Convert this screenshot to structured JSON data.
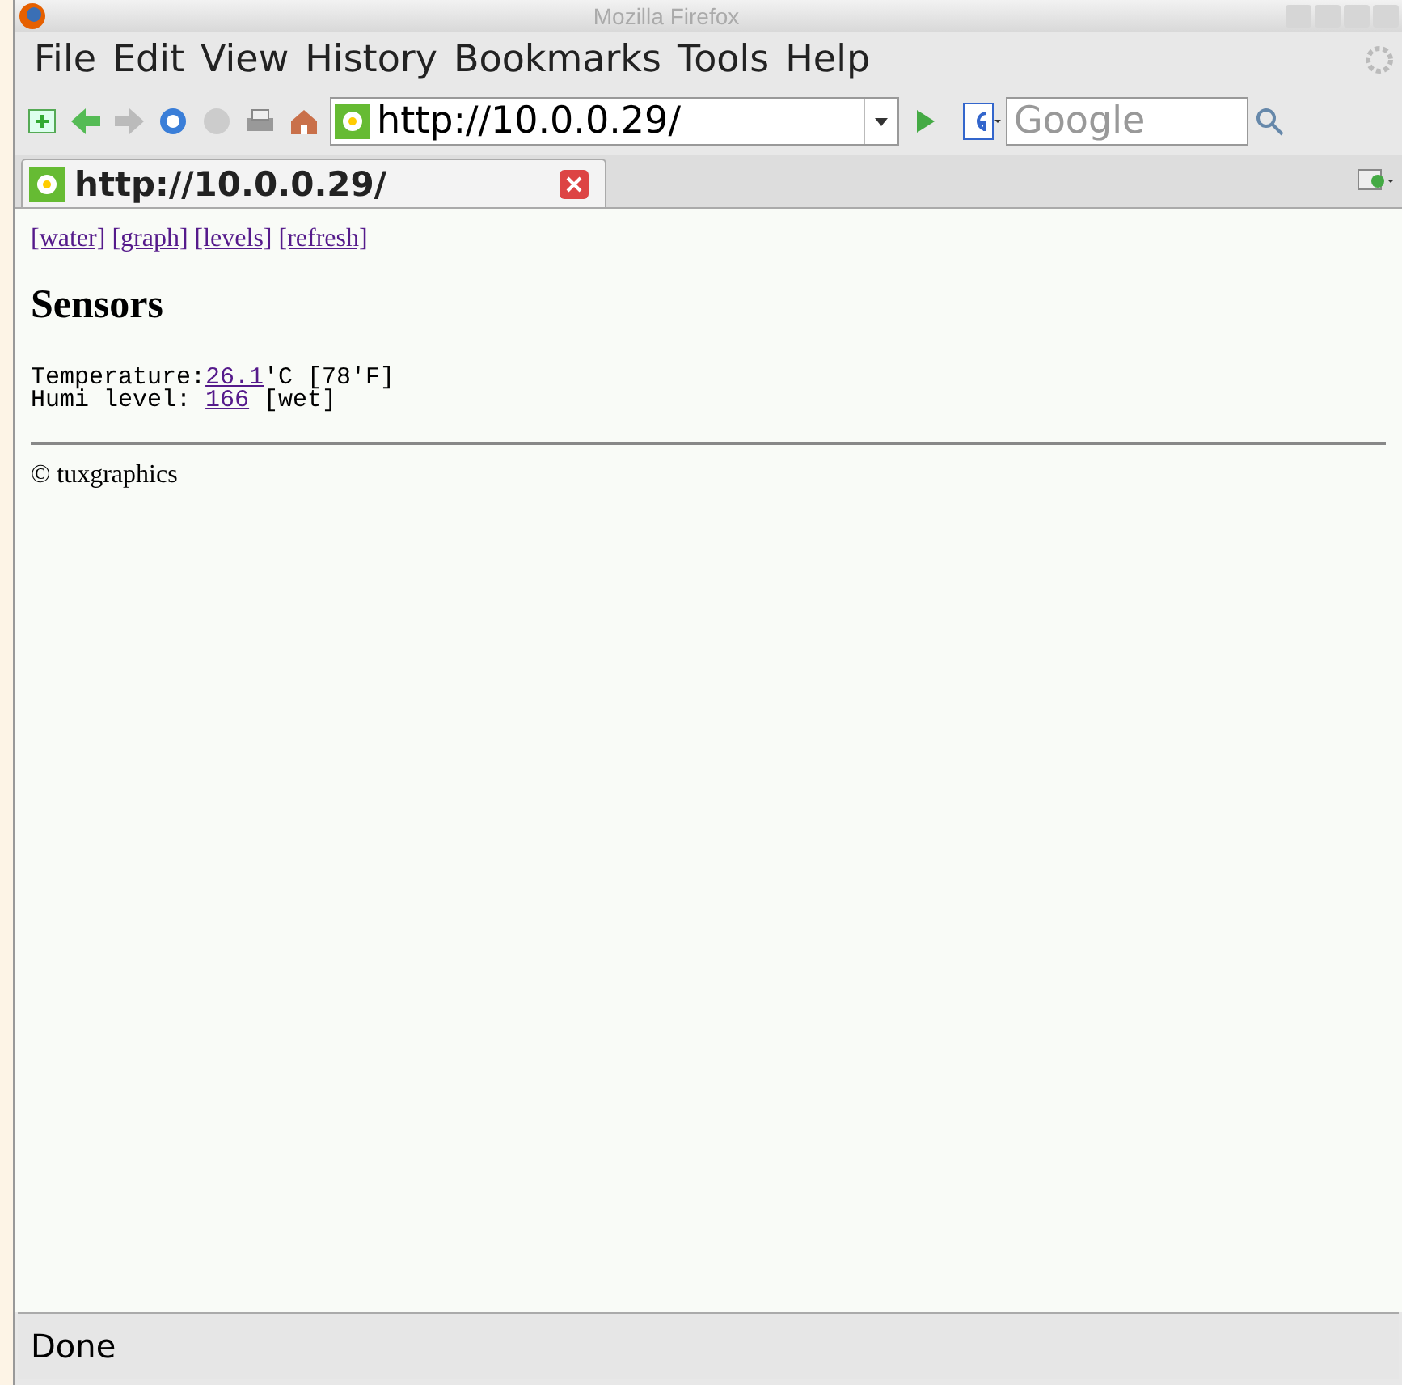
{
  "window": {
    "title": "Mozilla Firefox"
  },
  "menu": [
    "File",
    "Edit",
    "View",
    "History",
    "Bookmarks",
    "Tools",
    "Help"
  ],
  "address_bar": {
    "value": "http://10.0.0.29/"
  },
  "search": {
    "placeholder": "Google"
  },
  "tabs": [
    {
      "label": "http://10.0.0.29/",
      "selected": true
    }
  ],
  "page": {
    "nav_links": [
      "[water]",
      "[graph]",
      "[levels]",
      "[refresh]"
    ],
    "heading": "Sensors",
    "readings": [
      {
        "label": "Temperature:",
        "value": "26.1",
        "suffix": "'C [78'F]"
      },
      {
        "label": "Humi level: ",
        "value": "166",
        "suffix": " [wet]"
      }
    ],
    "footer": "© tuxgraphics"
  },
  "status_bar": "Done"
}
